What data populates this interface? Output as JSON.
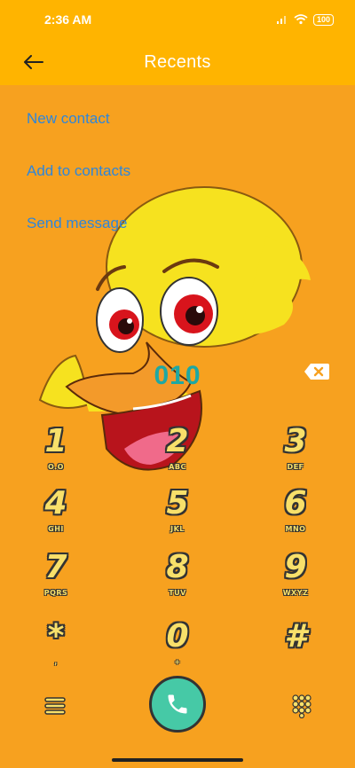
{
  "status": {
    "time": "2:36 AM",
    "battery": "100"
  },
  "header": {
    "title": "Recents"
  },
  "menu": {
    "items": [
      {
        "label": "New contact"
      },
      {
        "label": "Add to contacts"
      },
      {
        "label": "Send message"
      }
    ]
  },
  "dialer": {
    "number": "010",
    "keys": [
      {
        "digit": "1",
        "letters": "O.O"
      },
      {
        "digit": "2",
        "letters": "ABC"
      },
      {
        "digit": "3",
        "letters": "DEF"
      },
      {
        "digit": "4",
        "letters": "GHI"
      },
      {
        "digit": "5",
        "letters": "JKL"
      },
      {
        "digit": "6",
        "letters": "MNO"
      },
      {
        "digit": "7",
        "letters": "PQRS"
      },
      {
        "digit": "8",
        "letters": "TUV"
      },
      {
        "digit": "9",
        "letters": "WXYZ"
      },
      {
        "digit": "*",
        "letters": ","
      },
      {
        "digit": "0",
        "letters": "+"
      },
      {
        "digit": "#",
        "letters": ""
      }
    ]
  },
  "colors": {
    "background": "#F7A11F",
    "header": "#FFB400",
    "link": "#2F86D9",
    "number": "#1EA8A3",
    "call": "#46C9A6"
  },
  "icons": [
    "back-arrow-icon",
    "signal-icon",
    "wifi-icon",
    "battery-icon",
    "backspace-icon",
    "menu-icon",
    "phone-icon",
    "dialpad-icon"
  ]
}
